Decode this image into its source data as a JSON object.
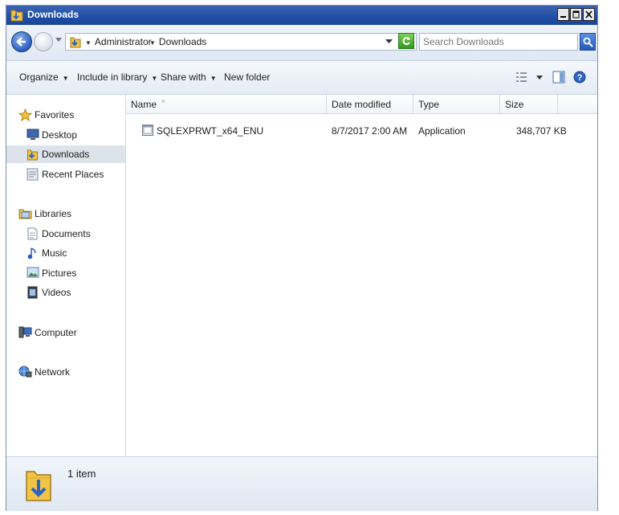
{
  "window": {
    "title": "Downloads",
    "controls": [
      "minimize",
      "maximize",
      "close"
    ]
  },
  "address": {
    "breadcrumb": [
      "Administrator",
      "Downloads"
    ],
    "search_placeholder": "Search Downloads"
  },
  "toolbar": {
    "organize": "Organize",
    "include_in_library": "Include in library",
    "share_with": "Share with",
    "new_folder": "New folder"
  },
  "nav": {
    "favorites": {
      "label": "Favorites",
      "items": [
        "Desktop",
        "Downloads",
        "Recent Places"
      ],
      "selected": "Downloads"
    },
    "libraries": {
      "label": "Libraries",
      "items": [
        "Documents",
        "Music",
        "Pictures",
        "Videos"
      ]
    },
    "computer": "Computer",
    "network": "Network"
  },
  "columns": {
    "name": "Name",
    "date_modified": "Date modified",
    "type": "Type",
    "size": "Size"
  },
  "files": [
    {
      "name": "SQLEXPRWT_x64_ENU",
      "date_modified": "8/7/2017 2:00 AM",
      "type": "Application",
      "size": "348,707 KB"
    }
  ],
  "status": {
    "item_count": "1 item"
  },
  "colors": {
    "titlebar": "#1f4ea5",
    "selection": "#dde3ea",
    "folder": "#e8b830"
  }
}
